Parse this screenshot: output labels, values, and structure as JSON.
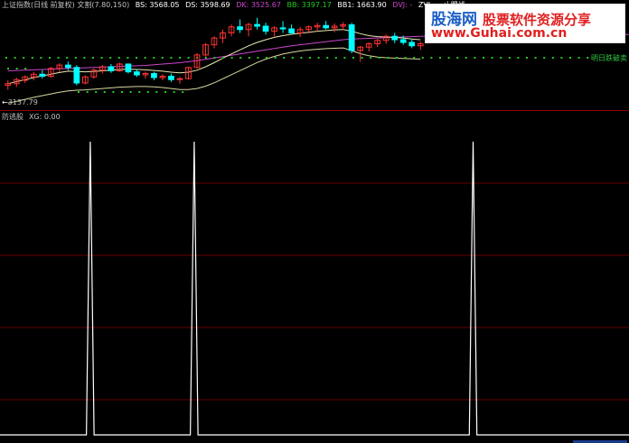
{
  "chart_data": [
    {
      "type": "candlestick",
      "title": "上证指数(日线 前复权) 文割(7.80,150)",
      "indicators": {
        "BS": "3568.05",
        "DS": "3598.69",
        "DK": "3525.67",
        "BB": "3397.17",
        "BB1": "1663.90",
        "DVJ": "-",
        "ZVJ": "-",
        "stop_line": "止蹋线: -"
      },
      "price_label": "3137.79",
      "annotation": "明日跌破卖",
      "candles": [
        {
          "o": 3145,
          "h": 3160,
          "l": 3132,
          "c": 3150
        },
        {
          "o": 3150,
          "h": 3168,
          "l": 3140,
          "c": 3162
        },
        {
          "o": 3160,
          "h": 3175,
          "l": 3152,
          "c": 3170
        },
        {
          "o": 3170,
          "h": 3185,
          "l": 3160,
          "c": 3178
        },
        {
          "o": 3178,
          "h": 3190,
          "l": 3165,
          "c": 3172
        },
        {
          "o": 3172,
          "h": 3200,
          "l": 3168,
          "c": 3195
        },
        {
          "o": 3195,
          "h": 3210,
          "l": 3185,
          "c": 3205
        },
        {
          "o": 3205,
          "h": 3215,
          "l": 3190,
          "c": 3198
        },
        {
          "o": 3198,
          "h": 3205,
          "l": 3145,
          "c": 3152
        },
        {
          "o": 3152,
          "h": 3175,
          "l": 3148,
          "c": 3170
        },
        {
          "o": 3170,
          "h": 3195,
          "l": 3165,
          "c": 3190
        },
        {
          "o": 3190,
          "h": 3205,
          "l": 3180,
          "c": 3200
        },
        {
          "o": 3200,
          "h": 3208,
          "l": 3182,
          "c": 3188
        },
        {
          "o": 3188,
          "h": 3212,
          "l": 3185,
          "c": 3208
        },
        {
          "o": 3208,
          "h": 3210,
          "l": 3180,
          "c": 3185
        },
        {
          "o": 3185,
          "h": 3192,
          "l": 3170,
          "c": 3176
        },
        {
          "o": 3176,
          "h": 3186,
          "l": 3165,
          "c": 3180
        },
        {
          "o": 3180,
          "h": 3185,
          "l": 3160,
          "c": 3168
        },
        {
          "o": 3168,
          "h": 3178,
          "l": 3160,
          "c": 3172
        },
        {
          "o": 3172,
          "h": 3180,
          "l": 3155,
          "c": 3162
        },
        {
          "o": 3162,
          "h": 3170,
          "l": 3150,
          "c": 3165
        },
        {
          "o": 3165,
          "h": 3200,
          "l": 3162,
          "c": 3198
        },
        {
          "o": 3198,
          "h": 3240,
          "l": 3195,
          "c": 3235
        },
        {
          "o": 3235,
          "h": 3270,
          "l": 3230,
          "c": 3265
        },
        {
          "o": 3265,
          "h": 3290,
          "l": 3255,
          "c": 3285
        },
        {
          "o": 3285,
          "h": 3310,
          "l": 3270,
          "c": 3300
        },
        {
          "o": 3300,
          "h": 3325,
          "l": 3290,
          "c": 3318
        },
        {
          "o": 3318,
          "h": 3340,
          "l": 3300,
          "c": 3310
        },
        {
          "o": 3310,
          "h": 3330,
          "l": 3290,
          "c": 3325
        },
        {
          "o": 3325,
          "h": 3345,
          "l": 3310,
          "c": 3320
        },
        {
          "o": 3320,
          "h": 3330,
          "l": 3295,
          "c": 3305
        },
        {
          "o": 3305,
          "h": 3320,
          "l": 3290,
          "c": 3315
        },
        {
          "o": 3315,
          "h": 3335,
          "l": 3300,
          "c": 3312
        },
        {
          "o": 3312,
          "h": 3325,
          "l": 3295,
          "c": 3300
        },
        {
          "o": 3300,
          "h": 3318,
          "l": 3288,
          "c": 3310
        },
        {
          "o": 3310,
          "h": 3322,
          "l": 3298,
          "c": 3318
        },
        {
          "o": 3318,
          "h": 3330,
          "l": 3305,
          "c": 3322
        },
        {
          "o": 3322,
          "h": 3335,
          "l": 3310,
          "c": 3315
        },
        {
          "o": 3315,
          "h": 3328,
          "l": 3302,
          "c": 3320
        },
        {
          "o": 3320,
          "h": 3332,
          "l": 3308,
          "c": 3324
        },
        {
          "o": 3324,
          "h": 3330,
          "l": 3240,
          "c": 3248
        },
        {
          "o": 3248,
          "h": 3262,
          "l": 3215,
          "c": 3258
        },
        {
          "o": 3258,
          "h": 3272,
          "l": 3245,
          "c": 3268
        },
        {
          "o": 3268,
          "h": 3282,
          "l": 3258,
          "c": 3278
        },
        {
          "o": 3278,
          "h": 3295,
          "l": 3268,
          "c": 3290
        },
        {
          "o": 3290,
          "h": 3300,
          "l": 3270,
          "c": 3280
        },
        {
          "o": 3280,
          "h": 3292,
          "l": 3265,
          "c": 3272
        },
        {
          "o": 3272,
          "h": 3282,
          "l": 3255,
          "c": 3262
        },
        {
          "o": 3262,
          "h": 3275,
          "l": 3250,
          "c": 3268
        }
      ],
      "ma_line": [
        3150,
        3156,
        3162,
        3168,
        3173,
        3178,
        3183,
        3187,
        3186,
        3185,
        3186,
        3188,
        3190,
        3192,
        3193,
        3192,
        3191,
        3189,
        3187,
        3184,
        3182,
        3184,
        3190,
        3200,
        3212,
        3225,
        3238,
        3250,
        3262,
        3272,
        3280,
        3287,
        3292,
        3296,
        3299,
        3302,
        3305,
        3307,
        3309,
        3310,
        3305,
        3298,
        3292,
        3289,
        3288,
        3287,
        3285,
        3282,
        3280
      ],
      "long_line": [
        3188,
        3189,
        3190,
        3191,
        3192,
        3193,
        3194,
        3195,
        3196,
        3197,
        3198,
        3199,
        3200,
        3201,
        3202,
        3203,
        3204,
        3206,
        3208,
        3210,
        3212,
        3215,
        3218,
        3222,
        3226,
        3230,
        3234,
        3238,
        3242,
        3246,
        3250,
        3254,
        3258,
        3262,
        3265,
        3268,
        3271,
        3274,
        3277,
        3280,
        3282,
        3283,
        3284,
        3285,
        3286,
        3287,
        3288,
        3289,
        3290
      ],
      "support_line": [
        3130,
        3135,
        3141,
        3147,
        3152,
        3157,
        3162,
        3166,
        3168,
        3169,
        3171,
        3173,
        3175,
        3177,
        3178,
        3179,
        3179,
        3178,
        3176,
        3173,
        3170,
        3170,
        3173,
        3180,
        3190,
        3202,
        3214,
        3226,
        3238,
        3250,
        3260,
        3268,
        3275,
        3280,
        3284,
        3287,
        3289,
        3291,
        3292,
        3293,
        3285,
        3276,
        3270,
        3266,
        3264,
        3263,
        3262,
        3261,
        3260
      ],
      "dots_low": [
        3165,
        3165,
        3165,
        3165,
        3165,
        3165,
        3165,
        3165,
        3165,
        3165,
        3165,
        3165,
        3165,
        3165,
        3165,
        3165,
        3165,
        3165,
        3165,
        3165,
        3165,
        3165,
        3165,
        3165,
        3165,
        3165,
        3165,
        3165,
        3165,
        3165,
        3165,
        3165,
        3165,
        3165,
        3165,
        3165,
        3165,
        3165,
        3165,
        3165,
        3165,
        3165,
        3165,
        3165,
        3165,
        3165,
        3165,
        3165,
        3165
      ],
      "ylim": [
        3120,
        3360
      ]
    },
    {
      "type": "line",
      "title": "防逃股",
      "series_label": "XG: 0.00",
      "x_count": 115,
      "spikes_at": [
        16,
        35,
        86
      ],
      "values_baseline": 0,
      "spike_value": 1,
      "ylim": [
        0,
        1.08
      ]
    }
  ],
  "watermark": {
    "brand_cn": "股海网",
    "slogan": "股票软件资源分享",
    "url": "www.Guhai.com.cn"
  },
  "colors": {
    "bg": "#000000",
    "up": "#ff3333",
    "down": "#00ffff",
    "ma": "#e8e8b0",
    "long": "#cc44cc",
    "dots": "#22cc22",
    "spike": "#ffffff",
    "grid": "#6a0000",
    "bs": "#ffffff",
    "ds": "#ffffff",
    "dk": "#cc44cc",
    "bb": "#22cc22",
    "bb1": "#ffffff",
    "dvj": "#cc44cc",
    "zvj": "#ffffff",
    "stop": "#ffffff"
  }
}
